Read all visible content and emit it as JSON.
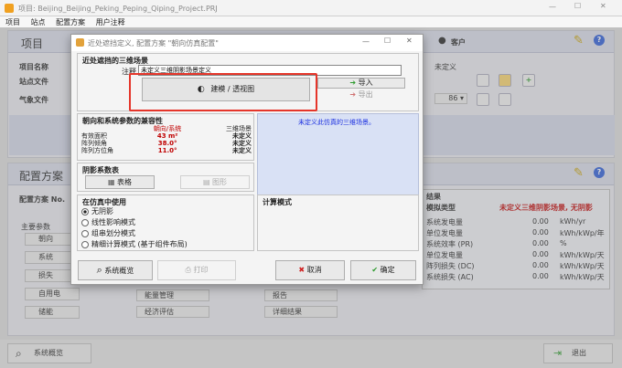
{
  "window": {
    "title": "项目: Beijing_Beijing_Peking_Peping_Qiping_Project.PRJ"
  },
  "menu": [
    "项目",
    "站点",
    "配置方案",
    "用户注释"
  ],
  "project_panel": {
    "title": "项目",
    "customer_label": "客户",
    "rows": [
      {
        "label": "项目名称"
      },
      {
        "label": "站点文件"
      },
      {
        "label": "气象文件"
      }
    ],
    "undefined_value": "未定义",
    "combo_value": "86"
  },
  "config_panel": {
    "title": "配置方案",
    "scheme_label": "配置方案 No.",
    "main_params_label": "主要参数",
    "params": [
      "朝向",
      "系统",
      "损失",
      "自用电",
      "储能"
    ],
    "mid_buttons": [
      "能量管理",
      "经济评估",
      "报告",
      "详细结果"
    ],
    "results_label": "结果",
    "sim_type_label": "模拟类型",
    "sim_type_value": "未定义三维阴影场景, 无阴影",
    "result_rows": [
      {
        "label": "系统发电量",
        "unit": "kWh/yr"
      },
      {
        "label": "单位发电量",
        "unit": "kWh/kWp/年"
      },
      {
        "label": "系统效率 (PR)",
        "unit": "%"
      },
      {
        "label": "单位发电量",
        "unit": "kWh/kWp/天"
      },
      {
        "label": "阵列损失 (DC)",
        "unit": "kWh/kWp/天"
      },
      {
        "label": "系统损失 (AC)",
        "unit": "kWh/kWp/天"
      }
    ],
    "result_value": "0.00"
  },
  "footer": {
    "overview_label": "系统概览",
    "exit_label": "退出"
  },
  "dialog": {
    "title": "近处遮挡定义, 配置方案 \"朝向仿真配置\"",
    "scene_group_label": "近处遮挡的三维场景",
    "comment_label": "注释",
    "comment_value": "未定义三维阴影场景定义",
    "build_button": "建模 / 透视图",
    "import_button": "导入",
    "export_button": "导出",
    "compare_group_label": "朝向和系统参数的兼容性",
    "compare_headers": [
      "",
      "朝向/系统",
      "三维场景"
    ],
    "compare_rows": [
      {
        "label": "有效面积",
        "system": "43 m²",
        "scene": "未定义"
      },
      {
        "label": "阵列倾角",
        "system": "38.0°",
        "scene": "未定义"
      },
      {
        "label": "阵列方位角",
        "system": "11.0°",
        "scene": "未定义"
      }
    ],
    "preview_text": "未定义此仿真的三维场景。",
    "shading_group_label": "阴影系数表",
    "table_button": "表格",
    "graph_button": "图形",
    "usage_group_label": "在仿真中使用",
    "usage_options": [
      {
        "label": "无阴影",
        "selected": true
      },
      {
        "label": "线性影响模式",
        "selected": false
      },
      {
        "label": "组串划分模式",
        "selected": false
      },
      {
        "label": "精细计算模式 (基于组件布局)",
        "selected": false
      }
    ],
    "calc_mode_label": "计算模式",
    "overview_button": "系统概览",
    "print_button": "打印",
    "cancel_button": "取消",
    "ok_button": "确定"
  },
  "colors": {
    "highlight": "#e5352a",
    "accent": "#2a5bd7"
  }
}
